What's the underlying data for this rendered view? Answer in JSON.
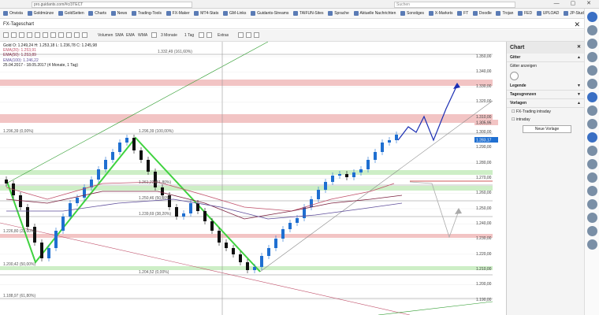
{
  "browser": {
    "url": "pro.guidants.com/#c/3TECT",
    "search_placeholder": "Suchen",
    "bookmarks": [
      "Onvista",
      "Goldmünze",
      "GoldSeiten",
      "Charts",
      "News",
      "Trading-Tools",
      "FX-Maker",
      "MT4-Stats",
      "GM-Links",
      "Guidants-Streams",
      "TAIFUN-Sites",
      "Sprache",
      "Aktuelle Nachrichten",
      "Sonstiges",
      "X-Markets",
      "FT",
      "Doodle",
      "Trojan",
      "FED",
      "UPLOAD",
      "JP-Studie"
    ]
  },
  "window": {
    "title": "FX-Tageschart",
    "close": "✕"
  },
  "toolbar": {
    "volume": "Volumen",
    "sma": "SMA",
    "ema": "EMA",
    "wma": "WMA",
    "range": "3 Monate",
    "interval": "1 Tag",
    "extras": "Extras"
  },
  "info": {
    "line1": "Gold  O: 1.249,24  H: 1.253,18  L: 1.236,78  C: 1.245,98",
    "ema20": "EMA(20): 1.253,91",
    "ema50": "EMA(50): 1.253,89",
    "ema100": "EMA(100): 1.246,22",
    "range": "25.04.2017 - 18.05.2017 (4 Monate, 1 Tag)"
  },
  "price_axis": [
    "1.350,00",
    "1.340,00",
    "1.330,00",
    "1.320,00",
    "1.310,00",
    "1.300,00",
    "1.290,00",
    "1.280,00",
    "1.270,00",
    "1.260,00",
    "1.250,00",
    "1.240,00",
    "1.230,00",
    "1.220,00",
    "1.210,00",
    "1.200,00",
    "1.190,00"
  ],
  "highlighted_prices": {
    "upper": "1.305,95",
    "current": "1.283,17"
  },
  "fib_labels": {
    "f161_top": "1.332,49 (161,60%)",
    "f0_top": "1.296,39 (0,00%)",
    "f100": "1.296,39 (100,00%)",
    "f61": "1.261,22 (61,80%)",
    "f50": "1.250,46 (50,00%)",
    "f38": "1.239,69 (38,20%)",
    "f0_bot": "1.204,52 (0,00%)",
    "f50_left": "1.200,42 (50,00%)",
    "f61_left": "1.188,97 (61,80%)",
    "f23_left": "1.226,80 (23,60%)"
  },
  "sidebar": {
    "title": "Chart",
    "close": "✕",
    "grid_section": "Gitter",
    "grid_label": "Gitter anzeigen",
    "legend_section": "Legende",
    "daily_limits_section": "Tagesgrenzen",
    "templates_section": "Vorlagen",
    "templates": [
      "FX-Trading intraday",
      "intraday"
    ],
    "new_template_button": "Neue Vorlage"
  },
  "colors": {
    "accent_blue": "#1f6fd1",
    "zone_red": "#f2c4c4",
    "zone_green": "#cdeec6",
    "candle_up": "#1f6fd1",
    "candle_down": "#111111",
    "zigzag": "#3fd23f"
  }
}
